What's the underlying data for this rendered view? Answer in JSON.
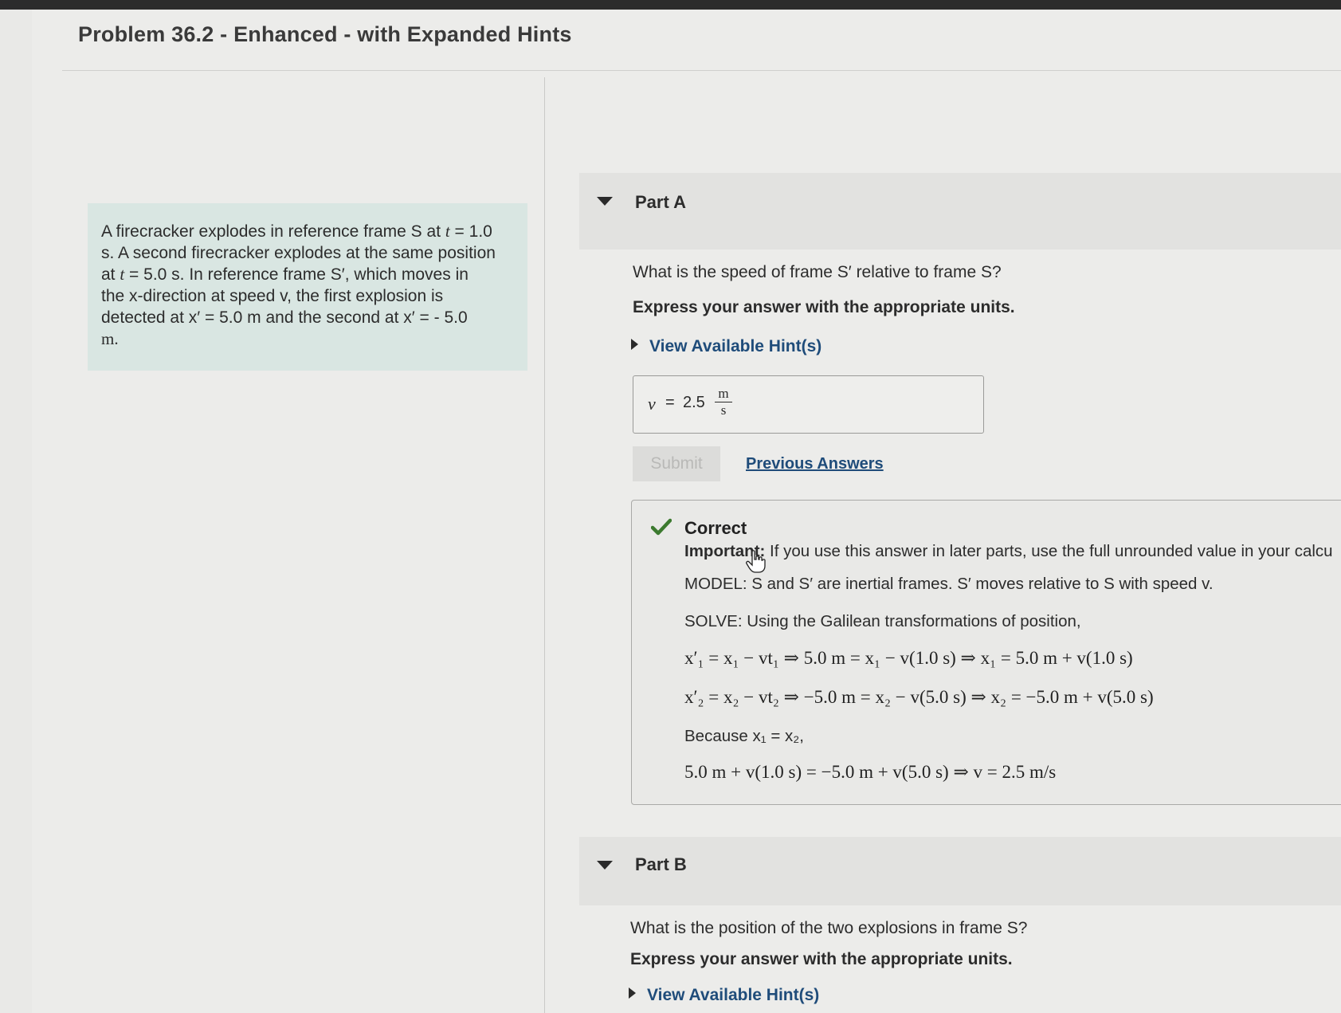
{
  "title": "Problem 36.2 - Enhanced - with Expanded Hints",
  "problem": {
    "t1_text": "A firecracker explodes in reference frame S at",
    "t1_var": "t",
    "t1_eq": " = 1.0",
    "line2": "s. A second firecracker explodes at the same position",
    "line3_a": "at ",
    "line3_var": "t",
    "line3_b": " = 5.0 s. In reference frame S′, which moves in",
    "line4": "the x-direction at speed v, the first explosion is",
    "line5": "detected at x′ = 5.0 m and the second at x′ = - 5.0",
    "line6": "m."
  },
  "part_a": {
    "label": "Part A",
    "question": "What is the speed of frame S′ relative to frame S?",
    "instruction": "Express your answer with the appropriate units.",
    "hint_link": "View Available Hint(s)",
    "answer_var": "v",
    "answer_eq": "=",
    "answer_value": "2.5",
    "answer_unit_num": "m",
    "answer_unit_den": "s",
    "submit_label": "Submit",
    "previous_answers_label": "Previous Answers",
    "feedback": {
      "title": "Correct",
      "important_label": "Important:",
      "important_text": " If you use this answer in later parts, use the full unrounded value in your calcu",
      "model": "MODEL: S and S′ are inertial frames. S′ moves relative to S with speed v.",
      "solve": "SOLVE: Using the Galilean transformations of position,",
      "eq1": "x′₁ = x₁ − vt₁ ⇒ 5.0 m = x₁ − v(1.0 s) ⇒ x₁ = 5.0 m + v(1.0 s)",
      "eq2": "x′₂ = x₂ − vt₂ ⇒ −5.0 m = x₂ − v(5.0 s) ⇒ x₂ = −5.0 m + v(5.0 s)",
      "because": "Because x₁ = x₂,",
      "eq3": "5.0 m + v(1.0 s) = −5.0 m + v(5.0 s) ⇒ v = 2.5 m/s"
    }
  },
  "part_b": {
    "label": "Part B",
    "question": "What is the position of the two explosions in frame S?",
    "instruction": "Express your answer with the appropriate units.",
    "hint_link": "View Available Hint(s)"
  },
  "colors": {
    "link": "#1f4c7a",
    "check": "#3c7a2f",
    "problem_bg": "#d9e6e2"
  }
}
